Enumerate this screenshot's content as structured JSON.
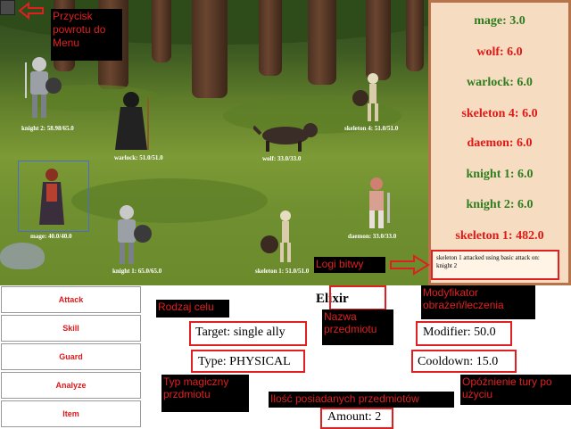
{
  "annotations": {
    "back_button": "Przycisk powrotu do Menu",
    "battle_logs": "Logi bitwy",
    "target_type": "Rodzaj celu",
    "item_name": "Nazwa przedmiotu",
    "modifier": "Modyfikator obrażeń/leczenia",
    "magic_type": "Typ magiczny przdmiotu",
    "amount": "Ilość posiadanych przedmiotów",
    "cooldown": "Opóźnienie tury po użyciu"
  },
  "battle": {
    "characters": [
      {
        "id": "knight2",
        "label": "knight 2: 58.98/65.0"
      },
      {
        "id": "warlock",
        "label": "warlock: 51.0/51.0"
      },
      {
        "id": "wolf",
        "label": "wolf: 33.0/33.0"
      },
      {
        "id": "skeleton4",
        "label": "skeleton 4: 51.0/51.0"
      },
      {
        "id": "mage",
        "label": "mage: 40.0/40.0"
      },
      {
        "id": "knight1",
        "label": "knight 1: 65.0/65.0"
      },
      {
        "id": "skeleton1",
        "label": "skeleton 1: 51.0/51.0"
      },
      {
        "id": "daemon",
        "label": "daemon: 33.0/33.0"
      }
    ]
  },
  "turn_order": [
    {
      "label": "mage: 3.0",
      "color": "#2e7d1f"
    },
    {
      "label": "wolf: 6.0",
      "color": "#e01818"
    },
    {
      "label": "warlock: 6.0",
      "color": "#2e7d1f"
    },
    {
      "label": "skeleton 4: 6.0",
      "color": "#e01818"
    },
    {
      "label": "daemon: 6.0",
      "color": "#e01818"
    },
    {
      "label": "knight 1: 6.0",
      "color": "#2e7d1f"
    },
    {
      "label": "knight 2: 6.0",
      "color": "#2e7d1f"
    },
    {
      "label": "skeleton 1: 482.0",
      "color": "#e01818"
    }
  ],
  "log": "skeleton 1 attacked using basic attack on: knight 2",
  "menu": {
    "attack": "Attack",
    "skill": "Skill",
    "guard": "Guard",
    "analyze": "Analyze",
    "item": "Item"
  },
  "item_details": {
    "name": "Elixir",
    "target": "Target: single ally",
    "type": "Type: PHYSICAL",
    "modifier": "Modifier: 50.0",
    "cooldown": "Cooldown: 15.0",
    "amount": "Amount: 2"
  }
}
